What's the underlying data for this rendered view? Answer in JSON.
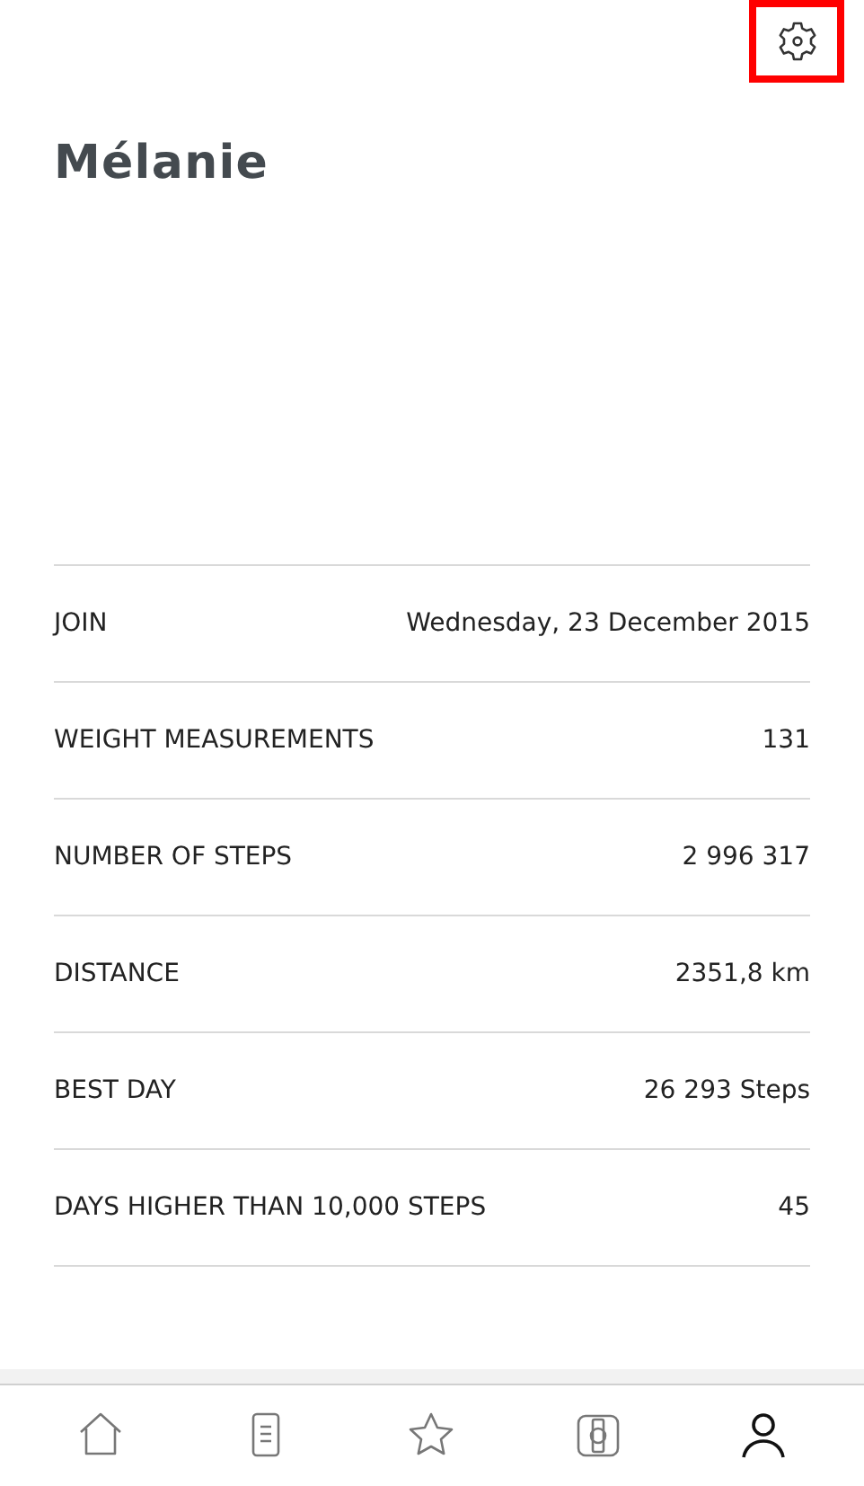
{
  "settings_button": {
    "highlighted": true
  },
  "profile": {
    "name": "Mélanie"
  },
  "stats": [
    {
      "label": "JOIN",
      "value": "Wednesday, 23 December 2015"
    },
    {
      "label": "WEIGHT MEASUREMENTS",
      "value": "131"
    },
    {
      "label": "NUMBER OF STEPS",
      "value": "2 996 317"
    },
    {
      "label": "DISTANCE",
      "value": "2351,8 km"
    },
    {
      "label": "BEST DAY",
      "value": "26 293 Steps"
    },
    {
      "label": "DAYS HIGHER THAN 10,000 STEPS",
      "value": "45"
    }
  ],
  "nav": [
    {
      "kind": "home",
      "selected": false
    },
    {
      "kind": "document",
      "selected": false
    },
    {
      "kind": "star",
      "selected": false
    },
    {
      "kind": "watch",
      "selected": false
    },
    {
      "kind": "person",
      "selected": true
    }
  ]
}
